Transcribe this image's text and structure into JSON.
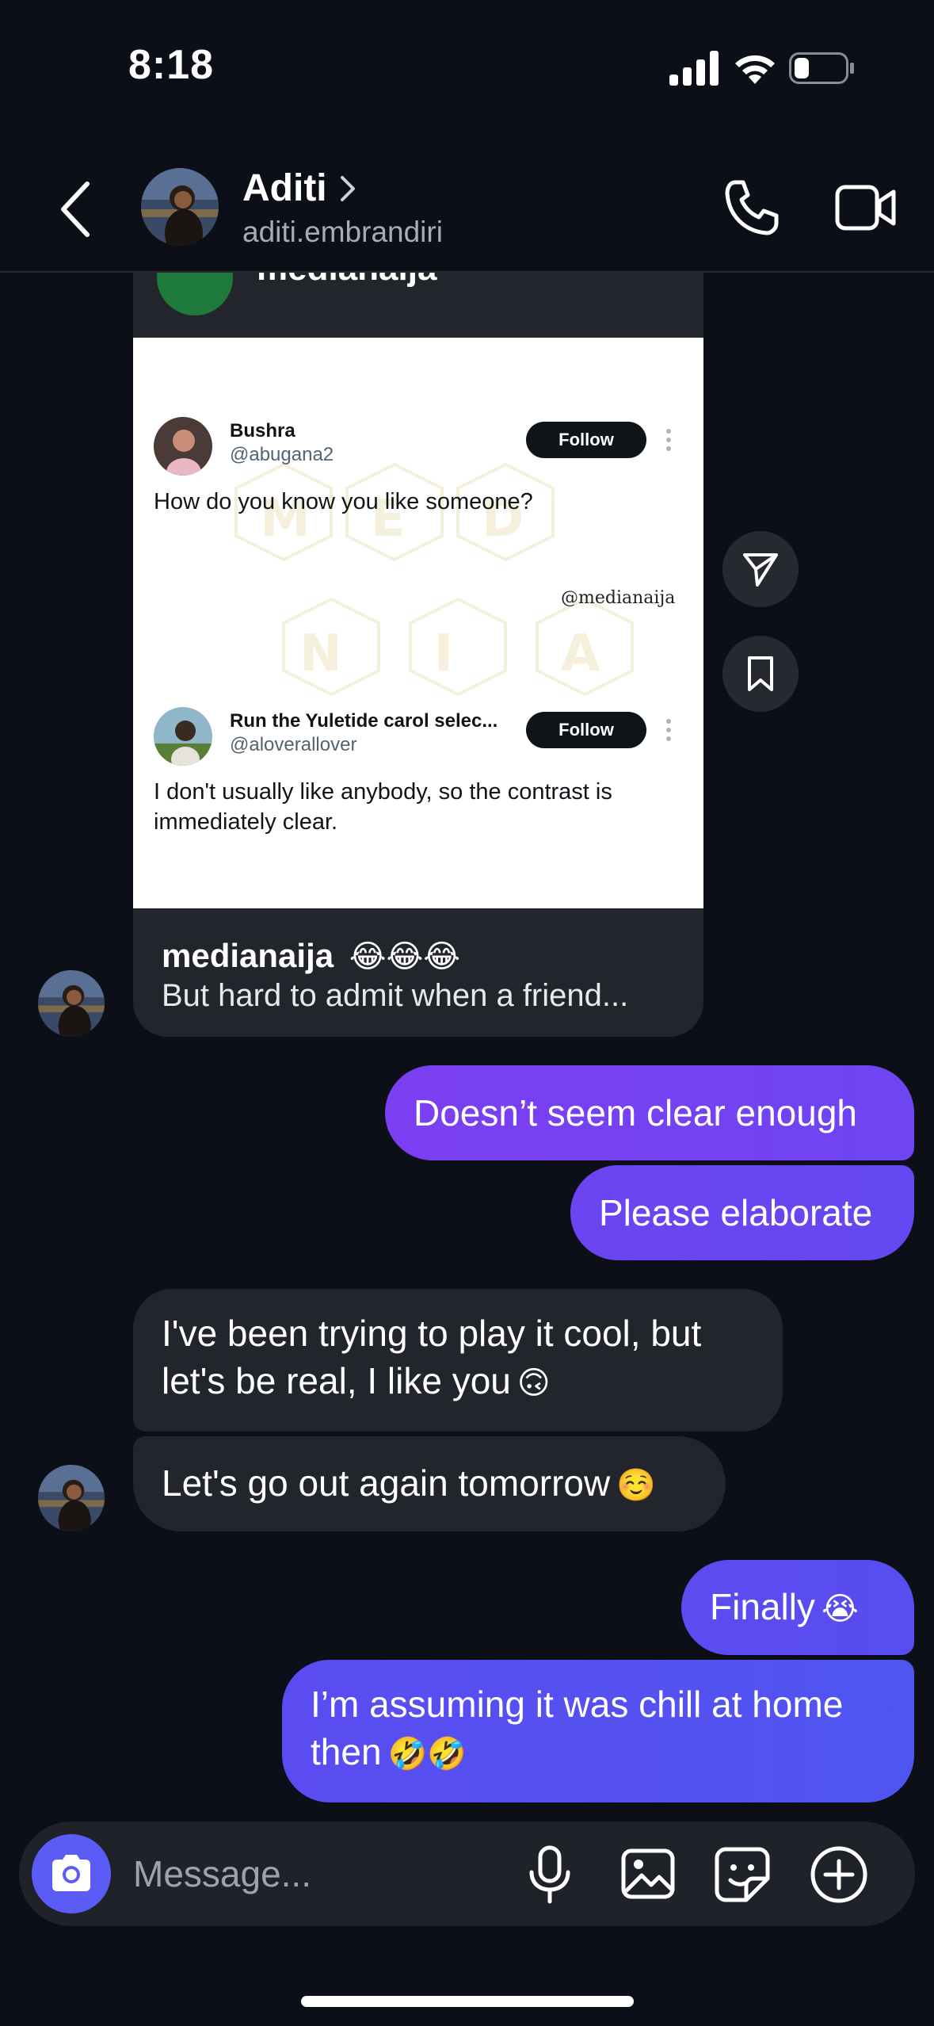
{
  "status_bar": {
    "time": "8:18"
  },
  "header": {
    "back_icon": "chevron-left-icon",
    "contact_name": "Aditi",
    "contact_handle": "aditi.embrandiri",
    "call_icon": "phone-icon",
    "video_icon": "video-camera-icon"
  },
  "shared_post": {
    "account": "medianaija",
    "tweets": [
      {
        "name": "Bushra",
        "handle": "@abugana2",
        "follow_label": "Follow",
        "text": "How do you know you like someone?"
      },
      {
        "name": "Run the Yuletide carol selec...",
        "handle": "@aloverallover",
        "follow_label": "Follow",
        "text": "I don't usually like anybody, so the contrast is immediately clear."
      }
    ],
    "credit": "@medianaija",
    "caption_account": "medianaija",
    "caption_emojis": "😂😂😂",
    "caption_text": "But hard to admit when a friend...",
    "share_icon": "paper-plane-icon",
    "save_icon": "bookmark-icon"
  },
  "messages": [
    {
      "direction": "out",
      "text": "Doesn’t seem clear enough"
    },
    {
      "direction": "out",
      "text": "Please elaborate"
    },
    {
      "direction": "in",
      "text": "I've been trying to play it cool, but let's be real, I like you",
      "emoji": "🙃"
    },
    {
      "direction": "in",
      "text": "Let's go out again tomorrow",
      "emoji": "☺️"
    },
    {
      "direction": "out",
      "text": "Finally",
      "emoji": "😭"
    },
    {
      "direction": "out",
      "text": "I’m assuming it was chill at home then",
      "emoji": "🤣🤣"
    }
  ],
  "composer": {
    "placeholder": "Message...",
    "camera_icon": "camera-icon",
    "mic_icon": "microphone-icon",
    "gallery_icon": "image-icon",
    "sticker_icon": "sticker-icon",
    "add_icon": "plus-circle-icon"
  },
  "colors": {
    "background": "#0c0f17",
    "incoming_bubble": "#22252c",
    "outgoing_gradient_start": "#7a3df2",
    "outgoing_gradient_end": "#4f55f0",
    "camera_button": "#5b5cf6"
  }
}
